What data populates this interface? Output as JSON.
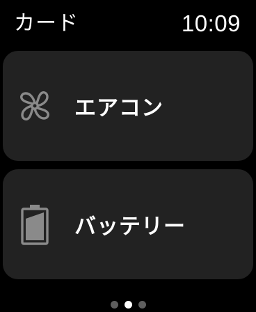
{
  "header": {
    "title": "カード",
    "time": "10:09"
  },
  "cards": [
    {
      "label": "エアコン",
      "icon": "fan-icon"
    },
    {
      "label": "バッテリー",
      "icon": "battery-icon",
      "battery_level": 0.75
    }
  ],
  "pagination": {
    "total": 3,
    "active_index": 1
  },
  "colors": {
    "background": "#000000",
    "card": "#222222",
    "icon": "#8a8a8a",
    "text": "#ffffff",
    "dot_inactive": "#5e5e5e",
    "dot_active": "#ffffff"
  }
}
